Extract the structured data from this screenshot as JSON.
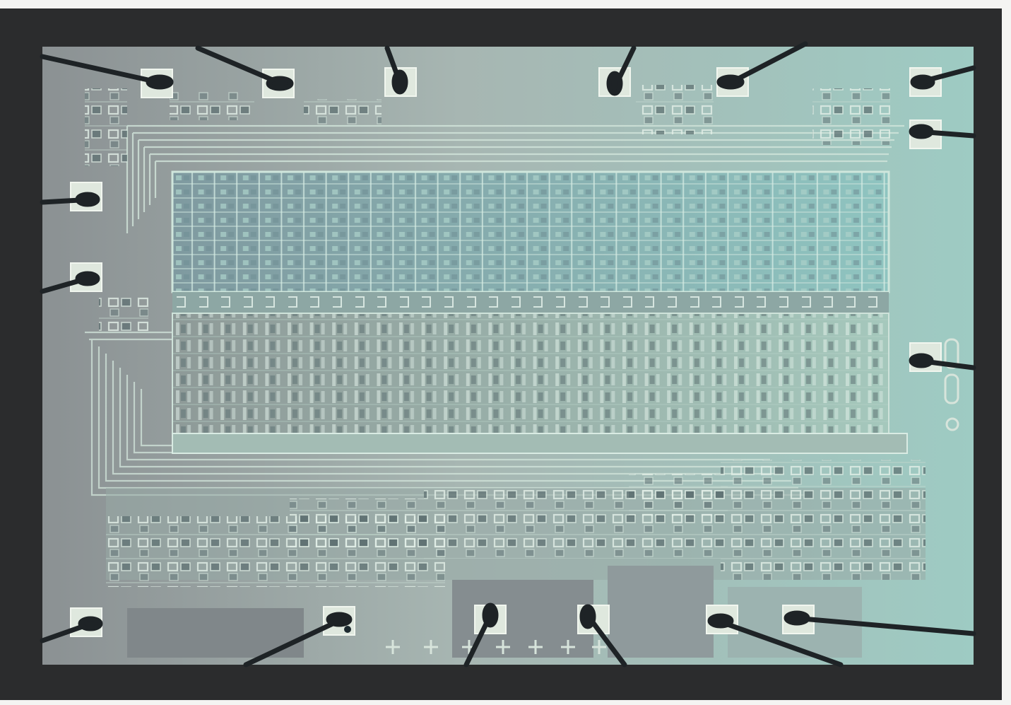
{
  "image": {
    "subject": "integrated-circuit-die-micrograph",
    "bonded_wire_count": 16,
    "colors": {
      "frame": "#2b2c2d",
      "die_left": "#8a9092",
      "die_right": "#9fc9c0",
      "metal_trace": "#cfe3d6",
      "memory_cell": "#86b0b0",
      "bond_wire": "#1d2226"
    }
  }
}
